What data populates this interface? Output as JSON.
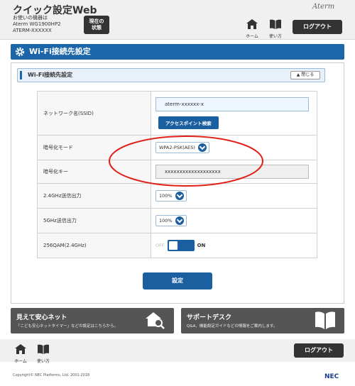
{
  "header": {
    "app_title": "クイック設定Web",
    "device_line1": "お使いの機器は",
    "device_line2": "Aterm WG1900HP2",
    "device_line3": "ATERM-XXXXXX",
    "status_button": "現在の\n状態",
    "brand": "Aterm",
    "home_label": "ホーム",
    "help_label": "使い方",
    "logout_label": "ログアウト"
  },
  "section": {
    "title": "Wi-Fi接続先設定",
    "subsection_title": "Wi-Fi接続先設定",
    "close_label": "閉じる"
  },
  "settings": {
    "ssid_label": "ネットワーク名(SSID)",
    "ssid_value": "aterm-xxxxxx-x",
    "ap_search_label": "アクセスポイント検索",
    "encryption_mode_label": "暗号化モード",
    "encryption_mode_value": "WPA2-PSK(AES)",
    "encryption_key_label": "暗号化キー",
    "encryption_key_value": "xxxxxxxxxxxxxxxxxxx",
    "tx_24_label": "2.4GHz送信出力",
    "tx_24_value": "100%",
    "tx_5_label": "5GHz送信出力",
    "tx_5_value": "100%",
    "qam_label": "256QAM(2.4GHz)",
    "qam_off": "OFF",
    "qam_on": "ON",
    "qam_state": "on"
  },
  "apply_label": "設定",
  "promo": {
    "left_title": "見えて安心ネット",
    "left_sub": "「こども安心ネットタイマー」などの設定はこちらから。",
    "right_title": "サポートデスク",
    "right_sub": "Q&A、機能設定ガイドなどの情報をご案内します。"
  },
  "footer": {
    "home_label": "ホーム",
    "help_label": "使い方",
    "logout_label": "ログアウト",
    "copyright": "Copyright© NEC Platforms, Ltd. 2001-2018",
    "nec_logo": "NEC"
  },
  "colors": {
    "accent": "#1a5fa0",
    "annotation": "#e0211a",
    "header_bg": "#f0f0f0"
  }
}
